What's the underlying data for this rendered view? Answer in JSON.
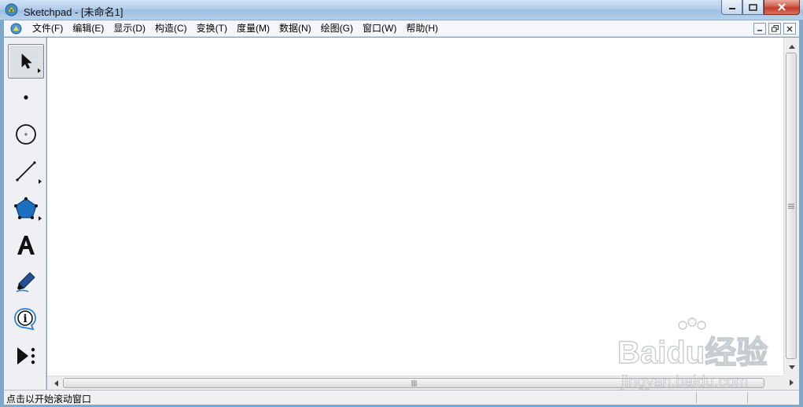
{
  "window": {
    "app_name": "Sketchpad",
    "title": "Sketchpad  - [未命名1]",
    "colors": {
      "titlebar": "#b3cde8",
      "close": "#c0392b",
      "canvas": "#ffffff"
    }
  },
  "menu": {
    "items": [
      {
        "label": "文件(F)"
      },
      {
        "label": "编辑(E)"
      },
      {
        "label": "显示(D)"
      },
      {
        "label": "构造(C)"
      },
      {
        "label": "变换(T)"
      },
      {
        "label": "度量(M)"
      },
      {
        "label": "数据(N)"
      },
      {
        "label": "绘图(G)"
      },
      {
        "label": "窗口(W)"
      },
      {
        "label": "帮助(H)"
      }
    ]
  },
  "toolbox": {
    "tools": [
      {
        "name": "selection-arrow-tool",
        "icon": "arrow-pointer-icon",
        "selected": true
      },
      {
        "name": "point-tool",
        "icon": "point-icon"
      },
      {
        "name": "compass-tool",
        "icon": "circle-icon"
      },
      {
        "name": "straightedge-tool",
        "icon": "segment-icon"
      },
      {
        "name": "polygon-tool",
        "icon": "polygon-icon"
      },
      {
        "name": "text-tool",
        "icon": "text-a-icon"
      },
      {
        "name": "marker-tool",
        "icon": "marker-pen-icon"
      },
      {
        "name": "information-tool",
        "icon": "info-icon"
      },
      {
        "name": "custom-tool",
        "icon": "custom-tools-icon"
      }
    ]
  },
  "status": {
    "text": "点击以开始滚动窗口"
  },
  "watermark": {
    "brand": "Baidu经验",
    "url": "jingyan.baidu.com"
  }
}
